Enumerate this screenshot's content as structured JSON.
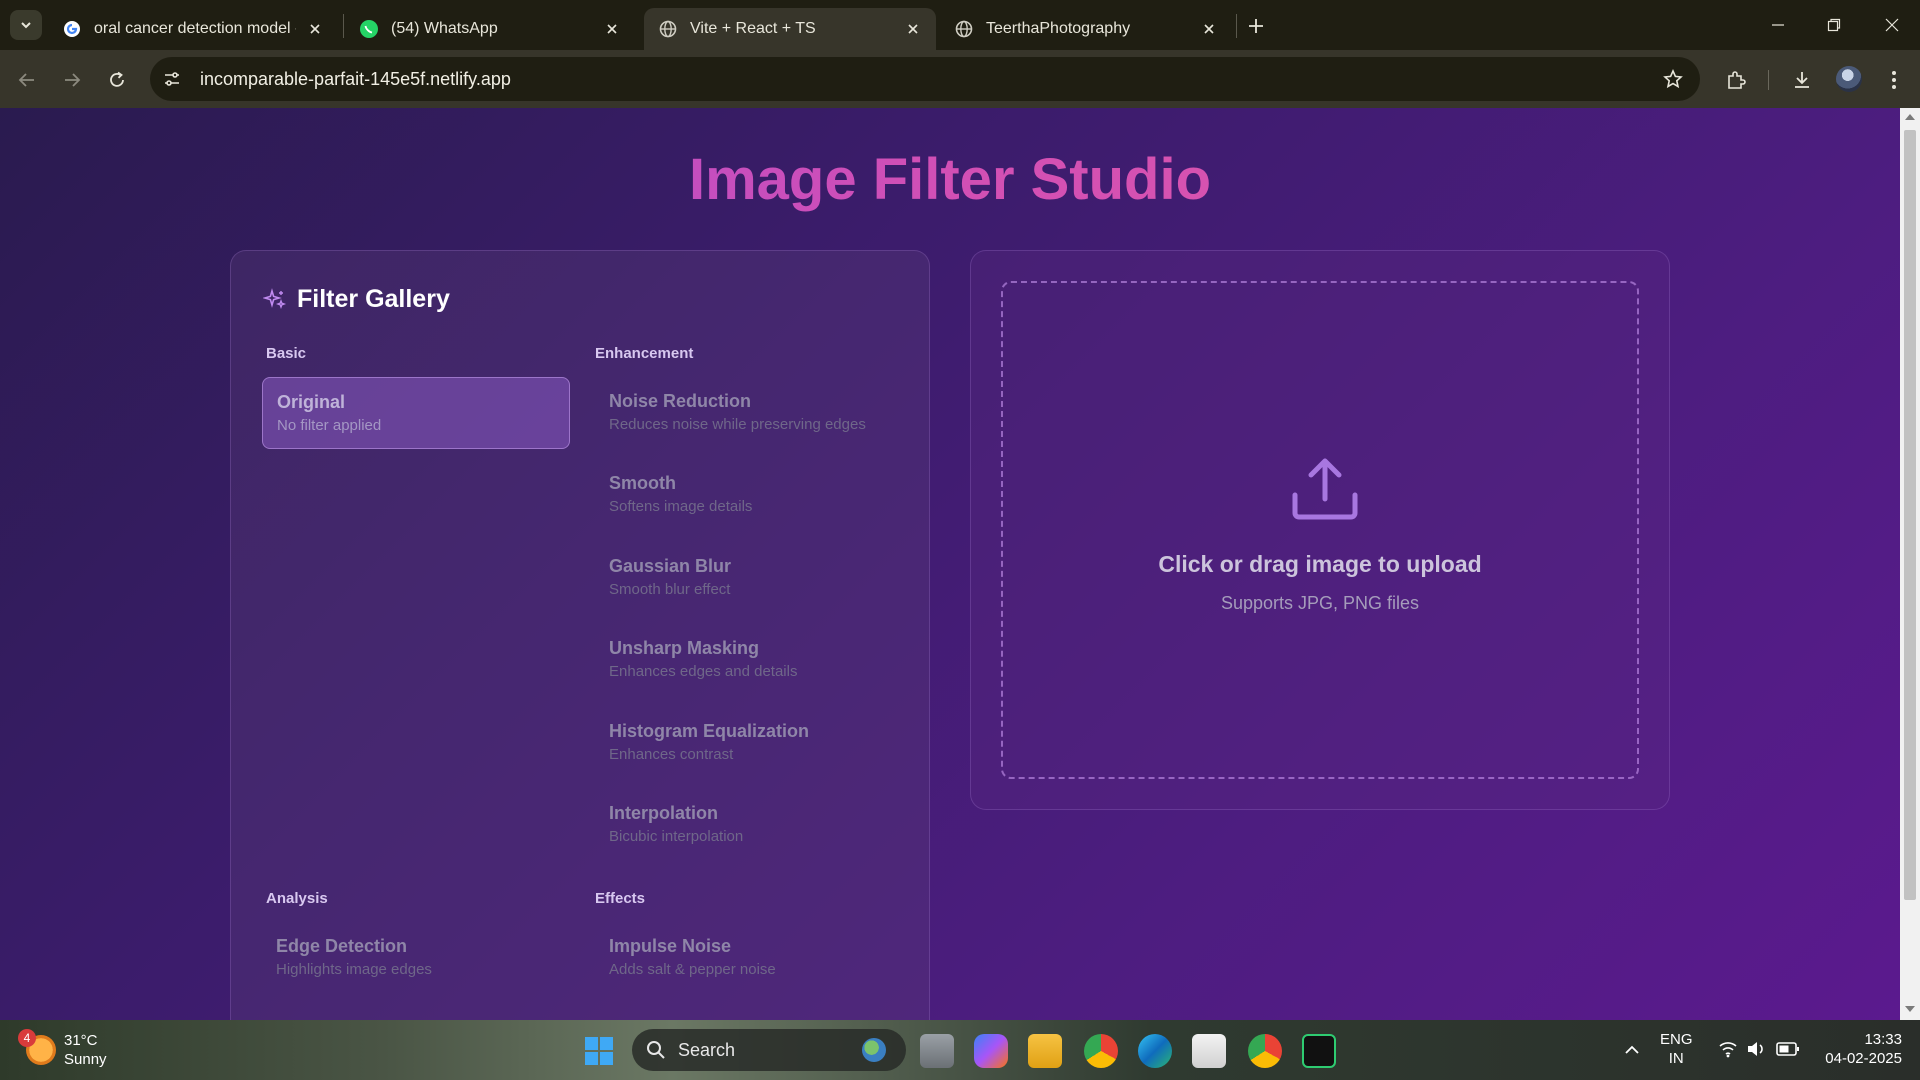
{
  "browser": {
    "tabs": [
      {
        "title": "oral cancer detection model - G",
        "icon": "google-icon",
        "active": false
      },
      {
        "title": "(54) WhatsApp",
        "icon": "whatsapp-icon",
        "active": false
      },
      {
        "title": "Vite + React + TS",
        "icon": "globe-icon",
        "active": true
      },
      {
        "title": "TeerthaPhotography",
        "icon": "globe-icon",
        "active": false
      }
    ],
    "url": "incomparable-parfait-145e5f.netlify.app"
  },
  "page": {
    "title": "Image Filter Studio",
    "gallery": {
      "title": "Filter Gallery",
      "groups": {
        "basic": "Basic",
        "enhancement": "Enhancement",
        "analysis": "Analysis",
        "effects": "Effects"
      },
      "filters": [
        {
          "name": "Original",
          "description": "No filter applied",
          "selected": true
        },
        {
          "name": "Noise Reduction",
          "description": "Reduces noise while preserving edges",
          "selected": false
        },
        {
          "name": "Smooth",
          "description": "Softens image details",
          "selected": false
        },
        {
          "name": "Gaussian Blur",
          "description": "Smooth blur effect",
          "selected": false
        },
        {
          "name": "Unsharp Masking",
          "description": "Enhances edges and details",
          "selected": false
        },
        {
          "name": "Histogram Equalization",
          "description": "Enhances contrast",
          "selected": false
        },
        {
          "name": "Interpolation",
          "description": "Bicubic interpolation",
          "selected": false
        },
        {
          "name": "Edge Detection",
          "description": "Highlights image edges",
          "selected": false
        },
        {
          "name": "Impulse Noise",
          "description": "Adds salt & pepper noise",
          "selected": false
        }
      ]
    },
    "upload": {
      "title": "Click or drag image to upload",
      "subtitle": "Supports JPG, PNG files"
    }
  },
  "taskbar": {
    "weather": {
      "temp": "31°C",
      "condition": "Sunny",
      "badge": "4"
    },
    "search_label": "Search",
    "lang": {
      "line1": "ENG",
      "line2": "IN"
    },
    "clock": {
      "time": "13:33",
      "date": "04-02-2025"
    }
  },
  "colors": {
    "accent": "#a24bd8",
    "title_gradient_end": "#e15aa4",
    "page_bg_start": "#2a1b4f",
    "page_bg_end": "#5b1a8e"
  }
}
